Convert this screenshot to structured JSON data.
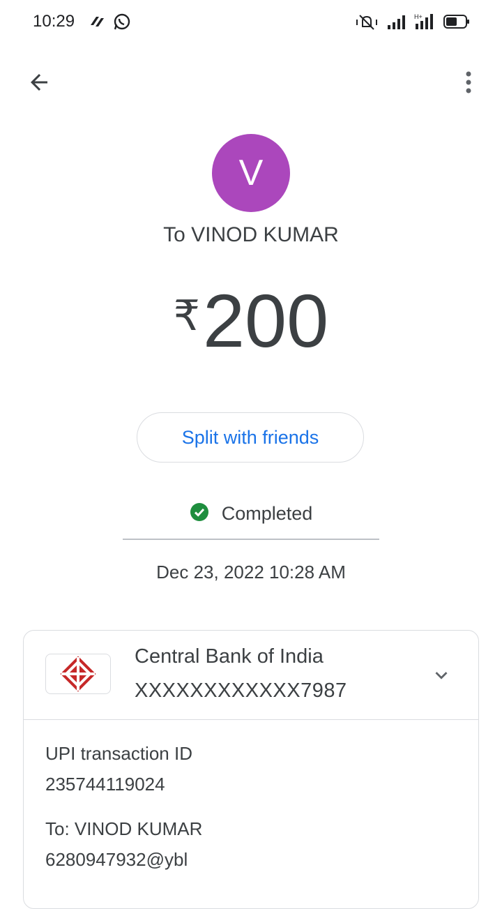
{
  "status_bar": {
    "time": "10:29",
    "icons": [
      "app-notification-icon",
      "whatsapp-icon",
      "vibrate-icon",
      "signal-icon",
      "hplus-signal-icon",
      "battery-icon"
    ]
  },
  "header": {
    "back_icon": "arrow-back-icon",
    "more_icon": "more-vert-icon"
  },
  "payee": {
    "avatar_letter": "V",
    "avatar_color": "#ab47bc",
    "recipient_line": "To VINOD KUMAR"
  },
  "payment": {
    "currency_symbol": "₹",
    "amount": "200"
  },
  "actions": {
    "split_label": "Split with friends"
  },
  "status": {
    "text": "Completed",
    "color": "#1e8e3e",
    "datetime": "Dec 23, 2022 10:28 AM"
  },
  "details": {
    "bank_name": "Central Bank of India",
    "account_number": "XXXXXXXXXXXX7987",
    "upi_id_label": "UPI transaction ID",
    "upi_id_value": "235744119024",
    "to_label": "To: VINOD KUMAR",
    "to_value": "6280947932@ybl"
  }
}
